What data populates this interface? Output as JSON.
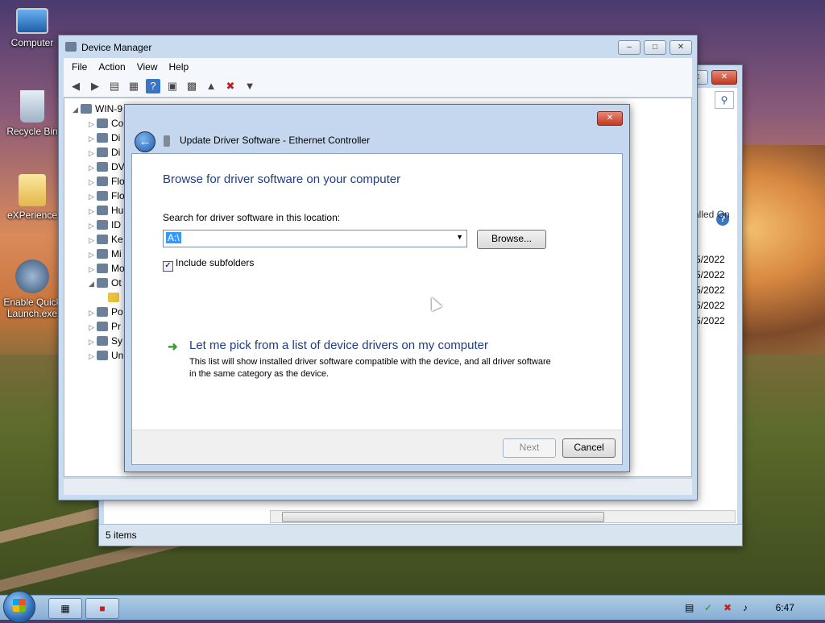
{
  "desktop": {
    "icons": [
      {
        "label": "Computer"
      },
      {
        "label": "Recycle Bin"
      },
      {
        "label": "eXPerience"
      },
      {
        "label": "Enable Quick Launch.exe"
      }
    ]
  },
  "explorer": {
    "column_header": "alled On",
    "dates": [
      "5/2022",
      "5/2022",
      "5/2022",
      "5/2022",
      "5/2022"
    ],
    "status": "5 items"
  },
  "device_manager": {
    "title": "Device Manager",
    "menu": [
      "File",
      "Action",
      "View",
      "Help"
    ],
    "tree": {
      "root": "WIN-9",
      "nodes": [
        "Co",
        "Di",
        "Di",
        "DV",
        "Flo",
        "Flo",
        "Hu",
        "ID",
        "Ke",
        "Mi",
        "Mo",
        "Ot",
        "Po",
        "Pr",
        "Sy",
        "Un"
      ]
    }
  },
  "dialog": {
    "title": "Update Driver Software - Ethernet Controller",
    "heading": "Browse for driver software on your computer",
    "search_label": "Search for driver software in this location:",
    "path_value": "A:\\",
    "browse_label": "Browse...",
    "include_subfolders": "Include subfolders",
    "pick_title": "Let me pick from a list of device drivers on my computer",
    "pick_desc": "This list will show installed driver software compatible with the device, and all driver software in the same category as the device.",
    "next_label": "Next",
    "cancel_label": "Cancel"
  },
  "taskbar": {
    "clock": "6:47"
  }
}
